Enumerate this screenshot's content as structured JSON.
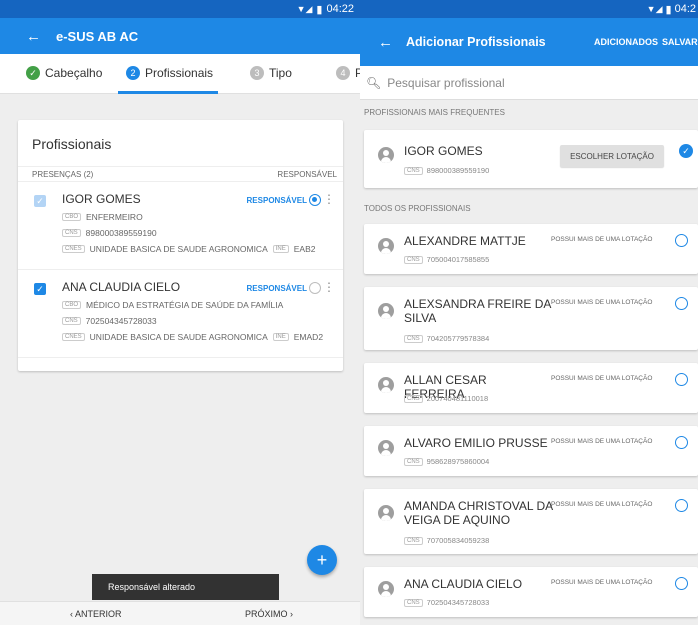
{
  "left": {
    "status_time": "04:22",
    "app_title": "e-SUS AB AC",
    "steps": [
      {
        "label": "Cabeçalho",
        "num": "✓"
      },
      {
        "label": "Profissionais",
        "num": "2"
      },
      {
        "label": "Tipo",
        "num": "3"
      },
      {
        "label": "P",
        "num": "4"
      }
    ],
    "card_title": "Profissionais",
    "presencas_label": "PRESENÇAS (2)",
    "responsavel_header": "RESPONSÁVEL",
    "professionals": [
      {
        "name": "IGOR GOMES",
        "cbo_tag": "CBO",
        "cbo": "ENFERMEIRO",
        "cns_tag": "CNS",
        "cns": "898000389559190",
        "cnes_tag": "CNES",
        "unidade": "UNIDADE BASICA DE SAUDE AGRONOMICA",
        "ine_tag": "INE",
        "ine": "EAB2",
        "resp_label": "RESPONSÁVEL",
        "selected_responsible": true
      },
      {
        "name": "ANA CLAUDIA CIELO",
        "cbo_tag": "CBO",
        "cbo": "MÉDICO DA ESTRATÉGIA DE SAÚDE DA FAMÍLIA",
        "cns_tag": "CNS",
        "cns": "702504345728033",
        "cnes_tag": "CNES",
        "unidade": "UNIDADE BASICA DE SAUDE AGRONOMICA",
        "ine_tag": "INE",
        "ine": "EMAD2",
        "resp_label": "RESPONSÁVEL",
        "selected_responsible": false
      }
    ],
    "snackbar": "Responsável alterado",
    "prev_label": "ANTERIOR",
    "next_label": "PRÓXIMO"
  },
  "right": {
    "status_time": "04:2",
    "title": "Adicionar Profissionais",
    "action_added": "ADICIONADOS",
    "action_save": "SALVAR",
    "search_placeholder": "Pesquisar profissional",
    "frequent_header": "PROFISSIONAIS MAIS FREQUENTES",
    "frequent": {
      "name": "IGOR GOMES",
      "cns_tag": "CNS",
      "cns": "898000389559190",
      "button": "ESCOLHER LOTAÇÃO"
    },
    "all_header": "TODOS OS PROFISSIONAIS",
    "multi_label": "POSSUI MAIS DE UMA LOTAÇÃO",
    "all": [
      {
        "name": "ALEXANDRE MATTJE",
        "cns": "705004017585855"
      },
      {
        "name": "ALEXSANDRA FREIRE DA SILVA",
        "cns": "704205779578384"
      },
      {
        "name": "ALLAN CESAR FERREIRA",
        "cns": "200740481110018"
      },
      {
        "name": "ALVARO EMILIO PRUSSE",
        "cns": "958628975860004"
      },
      {
        "name": "AMANDA CHRISTOVAL DA VEIGA DE AQUINO",
        "cns": "707005834059238"
      },
      {
        "name": "ANA CLAUDIA CIELO",
        "cns": "702504345728033"
      }
    ]
  },
  "colors": {
    "primary": "#1e88e5",
    "primary_dark": "#1565c0",
    "done": "#43a047"
  }
}
